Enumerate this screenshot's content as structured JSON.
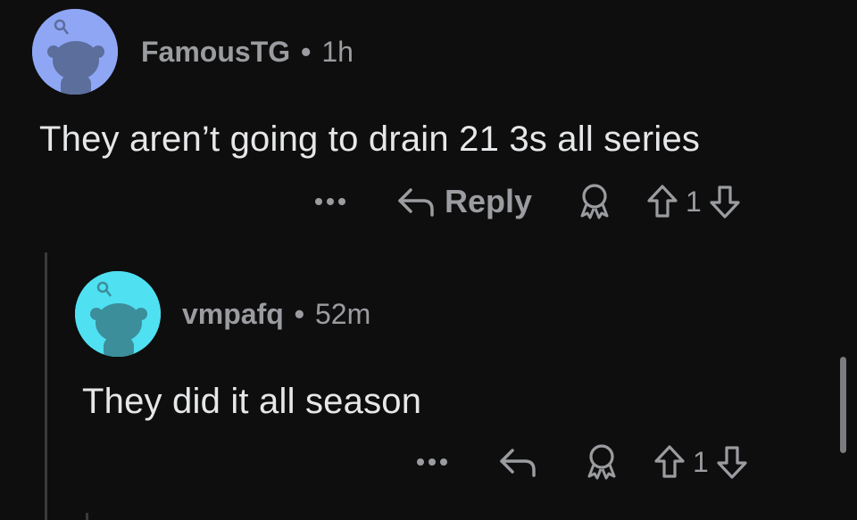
{
  "comments": [
    {
      "username": "FamousTG",
      "separator": "•",
      "time": "1h",
      "avatar_color": "#8fa6f5",
      "text": "They aren’t going to drain 21 3s all series",
      "actions": {
        "more_label": "•••",
        "reply_label": "Reply",
        "award_icon": "award-icon",
        "vote_count": "1"
      }
    },
    {
      "username": "vmpafq",
      "separator": "•",
      "time": "52m",
      "avatar_color": "#4fe0f2",
      "text": "They did it all season",
      "actions": {
        "more_label": "•••",
        "award_icon": "award-icon",
        "vote_count": "1"
      }
    }
  ],
  "colors": {
    "background": "#0e0e0e",
    "meta": "#9a9ca0",
    "body": "#e6e7e9",
    "thread_line": "#3a3a3c"
  }
}
